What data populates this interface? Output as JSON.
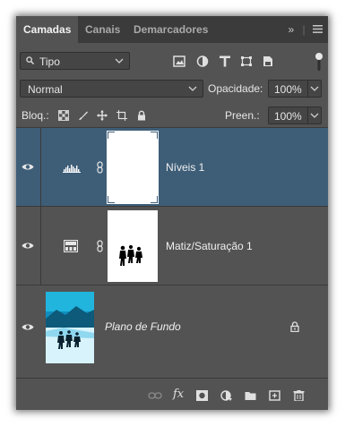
{
  "tabs": [
    {
      "label": "Camadas",
      "active": true
    },
    {
      "label": "Canais",
      "active": false
    },
    {
      "label": "Demarcadores",
      "active": false
    }
  ],
  "tab_bar": {
    "collapse_label": "»",
    "menu_icon": "hamburger-menu-icon"
  },
  "filter": {
    "selected": "Tipo",
    "icons": [
      "image-filter-icon",
      "adjustment-filter-icon",
      "type-filter-icon",
      "shape-filter-icon",
      "smart-object-filter-icon"
    ]
  },
  "blend": {
    "mode": "Normal",
    "opacity_label": "Opacidade:",
    "opacity_value": "100%"
  },
  "lock": {
    "label": "Bloq.:",
    "fill_label": "Preen.:",
    "fill_value": "100%",
    "icons": [
      "lock-transparent-icon",
      "lock-image-icon",
      "lock-position-icon",
      "lock-artboard-icon",
      "lock-all-icon"
    ]
  },
  "layers": [
    {
      "name": "Níveis 1",
      "type": "adjustment",
      "adjustment_icon": "levels-icon",
      "selected": true,
      "visible": true
    },
    {
      "name": "Matiz/Saturação 1",
      "type": "adjustment",
      "adjustment_icon": "hue-saturation-icon",
      "selected": false,
      "visible": true
    },
    {
      "name": "Plano de Fundo",
      "type": "background",
      "selected": false,
      "visible": true,
      "locked": true
    }
  ],
  "footer_icons": [
    "link-layers-icon",
    "fx-icon",
    "add-mask-icon",
    "new-fill-adjustment-icon",
    "new-group-icon",
    "new-layer-icon",
    "delete-icon"
  ],
  "footer": {
    "fx_label": "fx"
  },
  "colors": {
    "panel": "#535353",
    "tab_bar": "#3b3b3b",
    "selected_layer": "#3e5e78",
    "field": "#454545"
  }
}
